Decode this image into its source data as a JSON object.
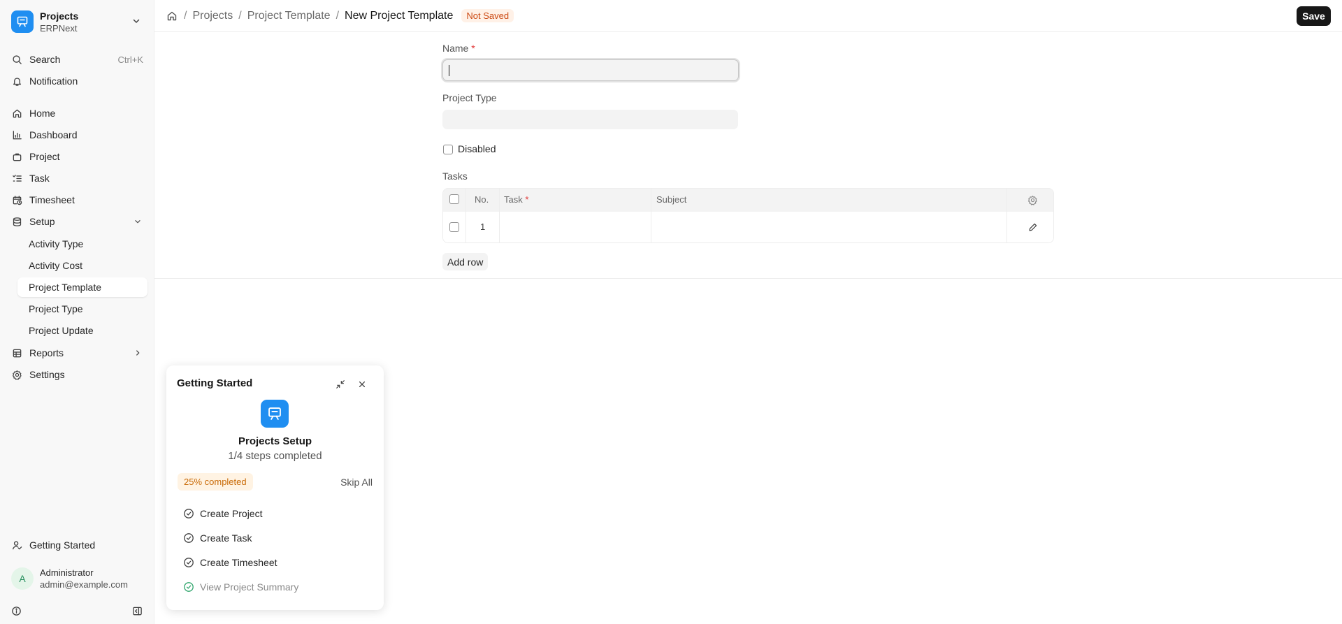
{
  "app": {
    "title": "Projects",
    "subtitle": "ERPNext"
  },
  "sidebar": {
    "search": {
      "label": "Search",
      "shortcut": "Ctrl+K"
    },
    "notification": "Notification",
    "items": [
      {
        "label": "Home",
        "icon": "home-icon"
      },
      {
        "label": "Dashboard",
        "icon": "chart-icon"
      },
      {
        "label": "Project",
        "icon": "briefcase-icon"
      },
      {
        "label": "Task",
        "icon": "checklist-icon"
      },
      {
        "label": "Timesheet",
        "icon": "calendar-clock-icon"
      }
    ],
    "setup": {
      "label": "Setup",
      "expanded": true,
      "children": [
        "Activity Type",
        "Activity Cost",
        "Project Template",
        "Project Type",
        "Project Update"
      ],
      "active": "Project Template"
    },
    "reports": "Reports",
    "settings": "Settings",
    "getting_started": "Getting Started",
    "user": {
      "initial": "A",
      "name": "Administrator",
      "email": "admin@example.com"
    }
  },
  "header": {
    "breadcrumbs": [
      "Projects",
      "Project Template"
    ],
    "current": "New Project Template",
    "status": "Not Saved",
    "save_label": "Save"
  },
  "form": {
    "name_label": "Name",
    "name_value": "",
    "project_type_label": "Project Type",
    "project_type_value": "",
    "disabled_label": "Disabled",
    "disabled_checked": false,
    "tasks_label": "Tasks",
    "table": {
      "columns": [
        "No.",
        "Task",
        "Subject"
      ],
      "rows": [
        {
          "no": "1",
          "task": "",
          "subject": ""
        }
      ]
    },
    "add_row_label": "Add row"
  },
  "getting_started": {
    "title": "Getting Started",
    "heading": "Projects Setup",
    "steps_text": "1/4 steps completed",
    "progress_label": "25% completed",
    "progress": 0.25,
    "skip_label": "Skip All",
    "steps": [
      {
        "label": "Create Project",
        "done": false
      },
      {
        "label": "Create Task",
        "done": false
      },
      {
        "label": "Create Timesheet",
        "done": false
      },
      {
        "label": "View Project Summary",
        "done": true
      }
    ]
  },
  "colors": {
    "accent": "#1f8ef1",
    "primary_button": "#171717",
    "badge_text": "#cc4a14",
    "badge_bg": "#fff1e7",
    "success": "#30a66d"
  }
}
